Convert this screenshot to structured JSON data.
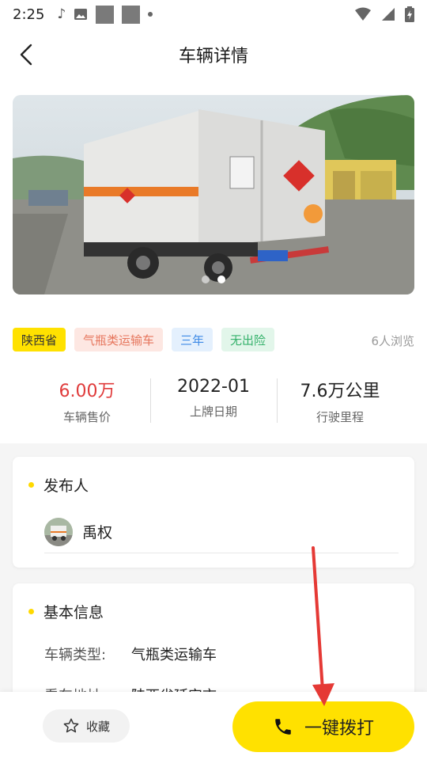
{
  "status_bar": {
    "time": "2:25"
  },
  "nav": {
    "title": "车辆详情"
  },
  "hero": {
    "slides": 2,
    "active_slide": 2
  },
  "tags": [
    {
      "label": "陕西省",
      "style": "yellow"
    },
    {
      "label": "气瓶类运输车",
      "style": "pink"
    },
    {
      "label": "三年",
      "style": "blue"
    },
    {
      "label": "无出险",
      "style": "green"
    }
  ],
  "views": "6人浏览",
  "stats": {
    "price": {
      "value": "6.00万",
      "label": "车辆售价"
    },
    "registration": {
      "value": "2022-01",
      "label": "上牌日期"
    },
    "mileage": {
      "value": "7.6万公里",
      "label": "行驶里程"
    }
  },
  "publisher": {
    "section_title": "发布人",
    "name": "禹权"
  },
  "basic_info": {
    "section_title": "基本信息",
    "rows": [
      {
        "label": "车辆类型:",
        "value": "气瓶类运输车"
      },
      {
        "label": "看车地址:",
        "value": "陕西省延安市"
      }
    ]
  },
  "actions": {
    "favorite_label": "收藏",
    "call_label": "一键拨打"
  },
  "colors": {
    "accent": "#ffe100",
    "price": "#e03b3b",
    "arrow": "#e53935"
  }
}
